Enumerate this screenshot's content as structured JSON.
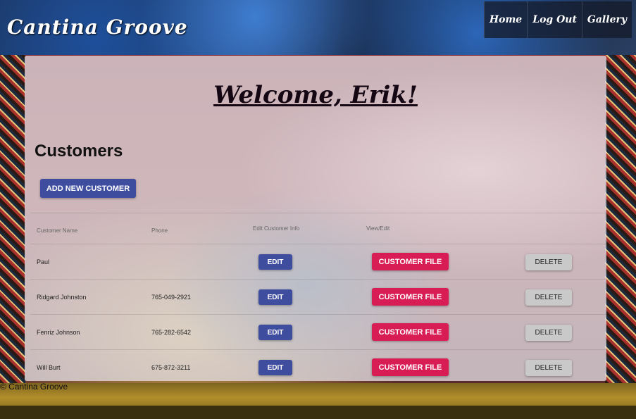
{
  "header": {
    "brand": "Cantina Groove",
    "nav": [
      {
        "label": "Home"
      },
      {
        "label": "Log Out"
      },
      {
        "label": "Gallery"
      }
    ]
  },
  "main": {
    "welcome": "Welcome, Erik!",
    "section_title": "Customers",
    "add_button": "ADD NEW CUSTOMER",
    "table": {
      "headers": [
        "Customer Name",
        "Phone",
        "Edit Customer Info",
        "View/Edit"
      ],
      "rows": [
        {
          "name": "Paul",
          "phone": "",
          "edit": "EDIT",
          "file": "CUSTOMER FILE",
          "delete": "DELETE"
        },
        {
          "name": "Ridgard Johnston",
          "phone": "765-049-2921",
          "edit": "EDIT",
          "file": "CUSTOMER FILE",
          "delete": "DELETE"
        },
        {
          "name": "Fenriz Johnson",
          "phone": "765-282-6542",
          "edit": "EDIT",
          "file": "CUSTOMER FILE",
          "delete": "DELETE"
        },
        {
          "name": "Will Burt",
          "phone": "675-872-3211",
          "edit": "EDIT",
          "file": "CUSTOMER FILE",
          "delete": "DELETE"
        }
      ]
    }
  },
  "footer": {
    "text": "© Cantina Groove"
  },
  "colors": {
    "primary_button": "#3f4d9f",
    "accent_button": "#d81c54",
    "neutral_button": "#c9c9ca"
  }
}
